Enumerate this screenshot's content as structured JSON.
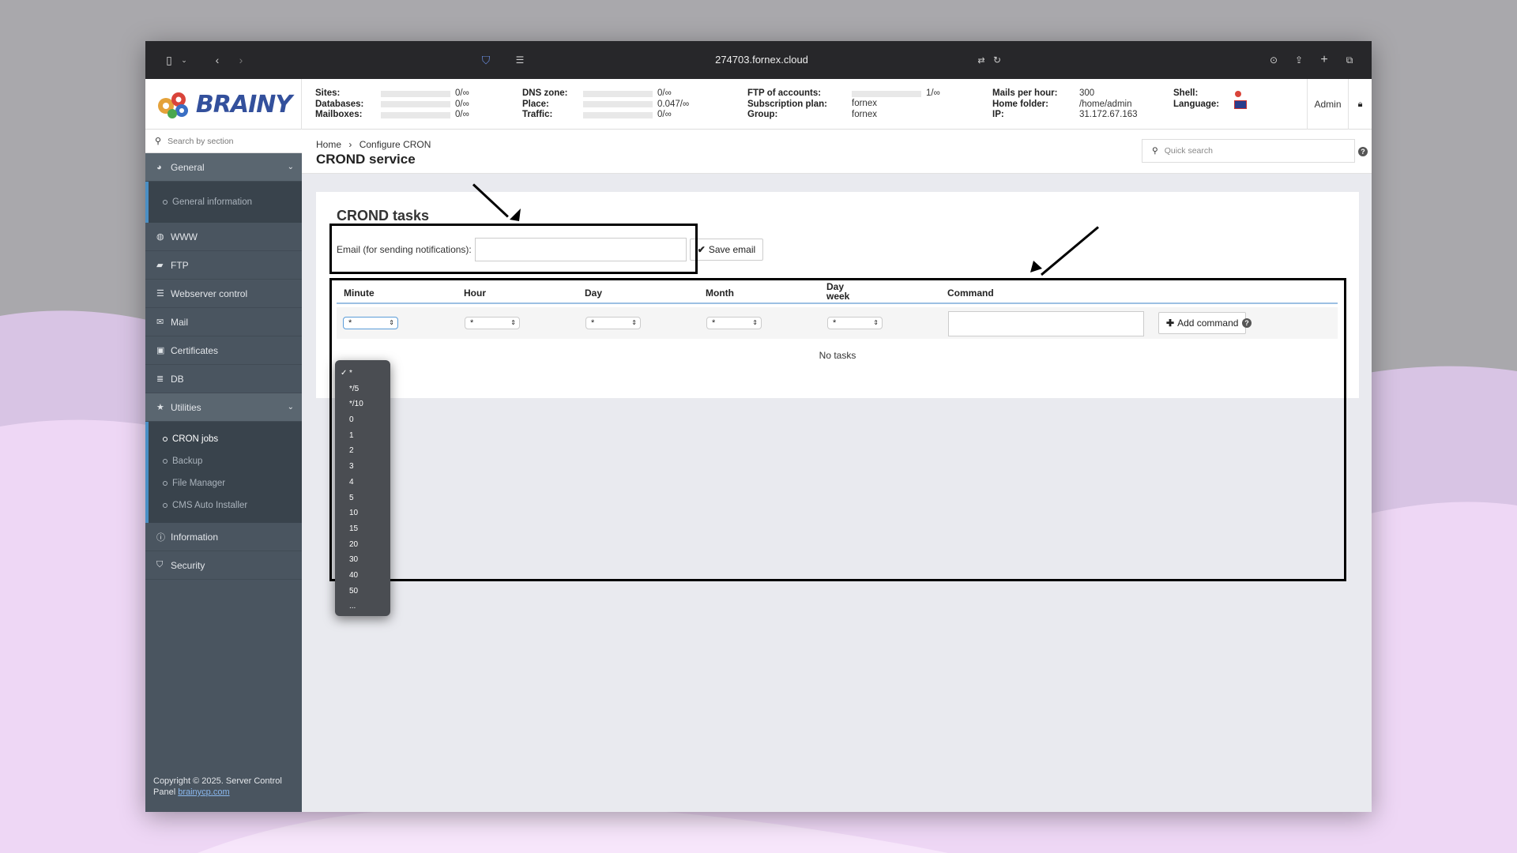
{
  "browser": {
    "url": "274703.fornex.cloud"
  },
  "header": {
    "logo_text": "BRAINY",
    "stats": [
      {
        "labels": [
          "Sites:",
          "Databases:",
          "Mailboxes:"
        ],
        "values": [
          "0/∞",
          "0/∞",
          "0/∞"
        ]
      },
      {
        "labels": [
          "DNS zone:",
          "Place:",
          "Traffic:"
        ],
        "values": [
          "0/∞",
          "0.047/∞",
          "0/∞"
        ]
      },
      {
        "labels": [
          "FTP of accounts:",
          "Subscription plan:",
          "Group:"
        ],
        "values": [
          "1/∞",
          "fornex",
          "fornex"
        ]
      },
      {
        "labels": [
          "Mails per hour:",
          "Home folder:",
          "IP:"
        ],
        "values": [
          "300",
          "/home/admin",
          "31.172.67.163"
        ]
      },
      {
        "labels": [
          "Shell:",
          "Language:"
        ],
        "values": [
          "",
          ""
        ]
      }
    ],
    "admin_label": "Admin"
  },
  "sidebar": {
    "search_placeholder": "Search by section",
    "items": [
      {
        "label": "General",
        "icon": "dashboard-icon",
        "expanded": true,
        "children": [
          "General information"
        ]
      },
      {
        "label": "WWW",
        "icon": "globe-icon"
      },
      {
        "label": "FTP",
        "icon": "folder-icon"
      },
      {
        "label": "Webserver control",
        "icon": "list-icon"
      },
      {
        "label": "Mail",
        "icon": "envelope-icon"
      },
      {
        "label": "Certificates",
        "icon": "lock-icon"
      },
      {
        "label": "DB",
        "icon": "database-icon"
      },
      {
        "label": "Utilities",
        "icon": "star-icon",
        "expanded": true,
        "children": [
          "CRON jobs",
          "Backup",
          "File Manager",
          "CMS Auto Installer"
        ]
      },
      {
        "label": "Information",
        "icon": "info-icon"
      },
      {
        "label": "Security",
        "icon": "shield-icon"
      }
    ],
    "copyright_text": "Copyright © 2025. Server Control Panel",
    "copyright_link": "brainycp.com"
  },
  "main": {
    "breadcrumb_home": "Home",
    "breadcrumb_current": "Configure CRON",
    "page_title": "CROND service",
    "quick_search_placeholder": "Quick search",
    "section_title": "CROND tasks",
    "email_label": "Email (for sending notifications):",
    "save_email_label": "Save email",
    "columns": [
      "Minute",
      "Hour",
      "Day",
      "Month",
      "Day week",
      "Command"
    ],
    "select_values": [
      "*",
      "*",
      "*",
      "*",
      "*"
    ],
    "add_command_label": "Add command",
    "no_tasks": "No tasks"
  },
  "minute_dropdown": {
    "selected": "*",
    "options": [
      "*",
      "*/5",
      "*/10",
      "0",
      "1",
      "2",
      "3",
      "4",
      "5",
      "10",
      "15",
      "20",
      "30",
      "40",
      "50",
      "..."
    ]
  }
}
